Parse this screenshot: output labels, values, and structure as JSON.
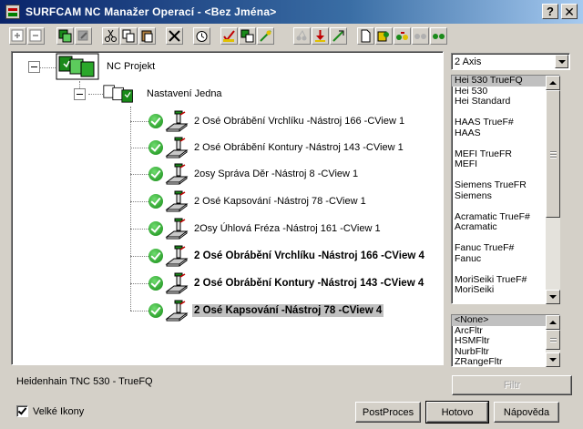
{
  "window": {
    "title": "SURFCAM NC Manažer Operací - <Bez Jména>",
    "help_glyph": "?",
    "close_glyph": "✕"
  },
  "toolbar": {
    "buttons": [
      "add-icon",
      "remove-icon",
      "copy-operation-icon",
      "paste-operation-icon",
      "cut-icon",
      "copy-icon",
      "paste-icon",
      "delete-icon",
      "clock-icon",
      "verify-icon",
      "edit-icon",
      "generate-icon",
      "multiaxis-icon",
      "move-down-icon",
      "transform-icon",
      "blank-page-icon",
      "post-icon",
      "toolpath-icon",
      "dots-icon",
      "green-dots-icon"
    ]
  },
  "tree": {
    "root": {
      "label": "NC Projekt",
      "icon": "project-folder-icon"
    },
    "setup": {
      "label": "Nastavení Jedna",
      "icon": "setup-folder-icon"
    },
    "operations": [
      {
        "label": "2 Osé Obrábění Vrchlíku  -Nástroj 166 -CView 1",
        "bold": false,
        "selected": false
      },
      {
        "label": "2 Osé Obrábění Kontury  -Nástroj 143 -CView 1",
        "bold": false,
        "selected": false
      },
      {
        "label": "2osy Správa Děr  -Nástroj 8 -CView 1",
        "bold": false,
        "selected": false
      },
      {
        "label": "2 Osé Kapsování  -Nástroj 78 -CView 1",
        "bold": false,
        "selected": false
      },
      {
        "label": "2Osy Úhlová Fréza  -Nástroj 161 -CView 1",
        "bold": false,
        "selected": false
      },
      {
        "label": "2 Osé Obrábění Vrchlíku  -Nástroj 166 -CView 4",
        "bold": true,
        "selected": false
      },
      {
        "label": "2 Osé Obrábění Kontury  -Nástroj 143 -CView 4",
        "bold": true,
        "selected": false
      },
      {
        "label": "2 Osé Kapsování  -Nástroj 78 -CView 4",
        "bold": true,
        "selected": true
      }
    ]
  },
  "axis_select": {
    "value": "2 Axis"
  },
  "post_list": {
    "items": [
      "Hei 530 TrueFQ",
      "Hei 530",
      "Hei Standard",
      "",
      "HAAS TrueF#",
      "HAAS",
      "",
      "MEFI TrueFR",
      "MEFI",
      "",
      "Siemens TrueFR",
      "Siemens",
      "",
      "Acramatic TrueF#",
      "Acramatic",
      "",
      "Fanuc TrueF#",
      "Fanuc",
      "",
      "MoriSeiki TrueF#",
      "MoriSeiki"
    ],
    "selected_index": 0
  },
  "filter_list": {
    "items": [
      "<None>",
      "ArcFltr",
      "HSMFltr",
      "NurbFltr",
      "ZRangeFltr"
    ],
    "selected_index": 0
  },
  "filter_button": {
    "label": "Filtr"
  },
  "status": {
    "text": "Heidenhain TNC 530 - TrueFQ"
  },
  "large_icons": {
    "label": "Velké Ikony",
    "checked": true
  },
  "buttons": {
    "postproces": "PostProces",
    "done": "Hotovo",
    "help": "Nápověda"
  }
}
